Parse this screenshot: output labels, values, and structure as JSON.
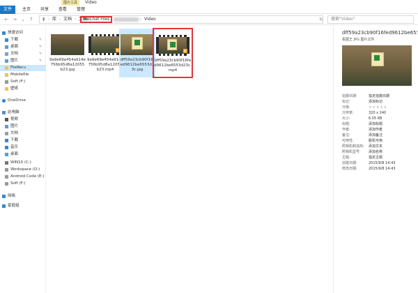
{
  "window": {
    "title": "Video",
    "context_tab": "图片工具"
  },
  "ribbon": {
    "tabs": [
      "文件",
      "主页",
      "共享",
      "查看",
      "管理"
    ]
  },
  "address": {
    "crumbs": [
      "库",
      "文档",
      "文档",
      "WeChat Files",
      "Video"
    ],
    "search_placeholder": "搜索\"Video\""
  },
  "sidebar": {
    "items": [
      {
        "label": "快速访问",
        "icon": "star-icon"
      },
      {
        "label": "下载",
        "icon": "download-icon"
      },
      {
        "label": "桌面",
        "icon": "desktop-icon"
      },
      {
        "label": "文档",
        "icon": "document-icon"
      },
      {
        "label": "图片",
        "icon": "picture-icon"
      },
      {
        "label": "FileRecv",
        "icon": "folder-icon"
      },
      {
        "label": "Mobilefile",
        "icon": "folder-icon"
      },
      {
        "label": "Soft (F:)",
        "icon": "drive-icon"
      },
      {
        "label": "壁纸",
        "icon": "folder-icon"
      },
      {
        "label": "OneDrive",
        "icon": "cloud-icon"
      },
      {
        "label": "此电脑",
        "icon": "computer-icon"
      },
      {
        "label": "视频",
        "icon": "video-icon"
      },
      {
        "label": "图片",
        "icon": "picture-icon"
      },
      {
        "label": "文档",
        "icon": "document-icon"
      },
      {
        "label": "下载",
        "icon": "download-icon"
      },
      {
        "label": "音乐",
        "icon": "music-icon"
      },
      {
        "label": "桌面",
        "icon": "desktop-icon"
      },
      {
        "label": "WIN10 (C:)",
        "icon": "drive-icon"
      },
      {
        "label": "Workspace (D:)",
        "icon": "drive-icon"
      },
      {
        "label": "Android Code (E:)",
        "icon": "drive-icon"
      },
      {
        "label": "Soft (F:)",
        "icon": "drive-icon"
      },
      {
        "label": "网络",
        "icon": "network-icon"
      },
      {
        "label": "家庭组",
        "icon": "homegroup-icon"
      }
    ]
  },
  "files": [
    {
      "name": "9a9e69e454a914e756b95d8a12055b23.jpg",
      "kind": "photo"
    },
    {
      "name": "9a9e69e454a914e756b95d8a12055b23.mp4",
      "kind": "video"
    },
    {
      "name": "dff59a23cb90f16fed9612be6553d23c.jpg",
      "kind": "photo"
    },
    {
      "name": "dff59a23cb90f16fed9612be6553d23c.mp4",
      "kind": "video"
    }
  ],
  "details": {
    "filename": "dff59a23cb90f16fed9612be6553d23c",
    "type": "看图王 JPG 图片文件",
    "props": [
      {
        "k": "拍摄日期:",
        "v": "指定拍摄日期"
      },
      {
        "k": "标记:",
        "v": "添加标记"
      },
      {
        "k": "分级:",
        "v": "☆☆☆☆☆"
      },
      {
        "k": "分辨率:",
        "v": "320 x 240"
      },
      {
        "k": "大小:",
        "v": "6.05 KB"
      },
      {
        "k": "标题:",
        "v": "添加标题"
      },
      {
        "k": "作者:",
        "v": "添加作者"
      },
      {
        "k": "备注:",
        "v": "添加备注"
      },
      {
        "k": "可用性:",
        "v": "脱机可用"
      },
      {
        "k": "照相机制造商:",
        "v": "添加文本"
      },
      {
        "k": "照相机型号:",
        "v": "添加名称"
      },
      {
        "k": "主题:",
        "v": "指定主题"
      },
      {
        "k": "创建日期:",
        "v": "2015/9/8 14:43"
      },
      {
        "k": "修改日期:",
        "v": "2015/9/8 14:43"
      }
    ]
  }
}
